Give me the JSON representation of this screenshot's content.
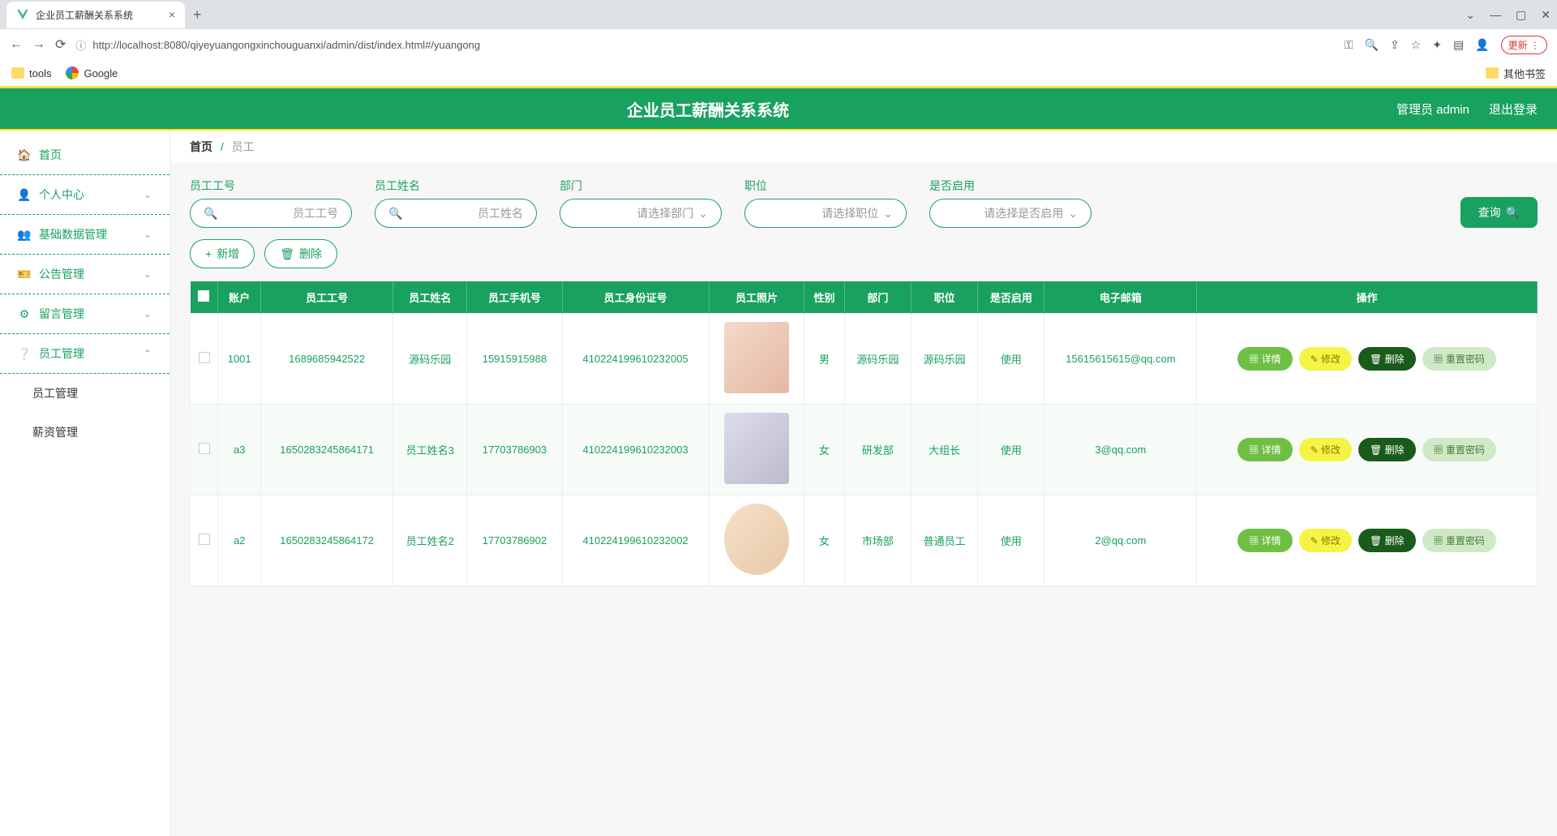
{
  "browser": {
    "tab_title": "企业员工薪酬关系系统",
    "url": "http://localhost:8080/qiyeyuangongxinchouguanxi/admin/dist/index.html#/yuangong",
    "update_label": "更新",
    "bookmarks": {
      "tools": "tools",
      "google": "Google",
      "other": "其他书签"
    }
  },
  "header": {
    "title": "企业员工薪酬关系系统",
    "admin": "管理员 admin",
    "logout": "退出登录"
  },
  "sidebar": {
    "items": [
      {
        "label": "首页"
      },
      {
        "label": "个人中心"
      },
      {
        "label": "基础数据管理"
      },
      {
        "label": "公告管理"
      },
      {
        "label": "留言管理"
      },
      {
        "label": "员工管理"
      }
    ],
    "sub": [
      {
        "label": "员工管理"
      },
      {
        "label": "薪资管理"
      }
    ]
  },
  "breadcrumb": {
    "home": "首页",
    "current": "员工"
  },
  "filters": {
    "emp_id": {
      "label": "员工工号",
      "placeholder": "员工工号"
    },
    "emp_name": {
      "label": "员工姓名",
      "placeholder": "员工姓名"
    },
    "dept": {
      "label": "部门",
      "placeholder": "请选择部门"
    },
    "position": {
      "label": "职位",
      "placeholder": "请选择职位"
    },
    "enabled": {
      "label": "是否启用",
      "placeholder": "请选择是否启用"
    },
    "query": "查询"
  },
  "actions": {
    "add": "新增",
    "delete": "删除"
  },
  "table": {
    "headers": [
      "账户",
      "员工工号",
      "员工姓名",
      "员工手机号",
      "员工身份证号",
      "员工照片",
      "性别",
      "部门",
      "职位",
      "是否启用",
      "电子邮箱",
      "操作"
    ],
    "ops": {
      "detail": "详情",
      "edit": "修改",
      "delete": "删除",
      "reset": "重置密码"
    },
    "rows": [
      {
        "account": "1001",
        "emp_id": "1689685942522",
        "name": "源码乐园",
        "phone": "15915915988",
        "idcard": "410224199610232005",
        "gender": "男",
        "dept": "源码乐园",
        "position": "源码乐园",
        "enabled": "使用",
        "email": "15615615615@qq.com"
      },
      {
        "account": "a3",
        "emp_id": "1650283245864171",
        "name": "员工姓名3",
        "phone": "17703786903",
        "idcard": "410224199610232003",
        "gender": "女",
        "dept": "研发部",
        "position": "大组长",
        "enabled": "使用",
        "email": "3@qq.com"
      },
      {
        "account": "a2",
        "emp_id": "1650283245864172",
        "name": "员工姓名2",
        "phone": "17703786902",
        "idcard": "410224199610232002",
        "gender": "女",
        "dept": "市场部",
        "position": "普通员工",
        "enabled": "使用",
        "email": "2@qq.com"
      }
    ]
  }
}
